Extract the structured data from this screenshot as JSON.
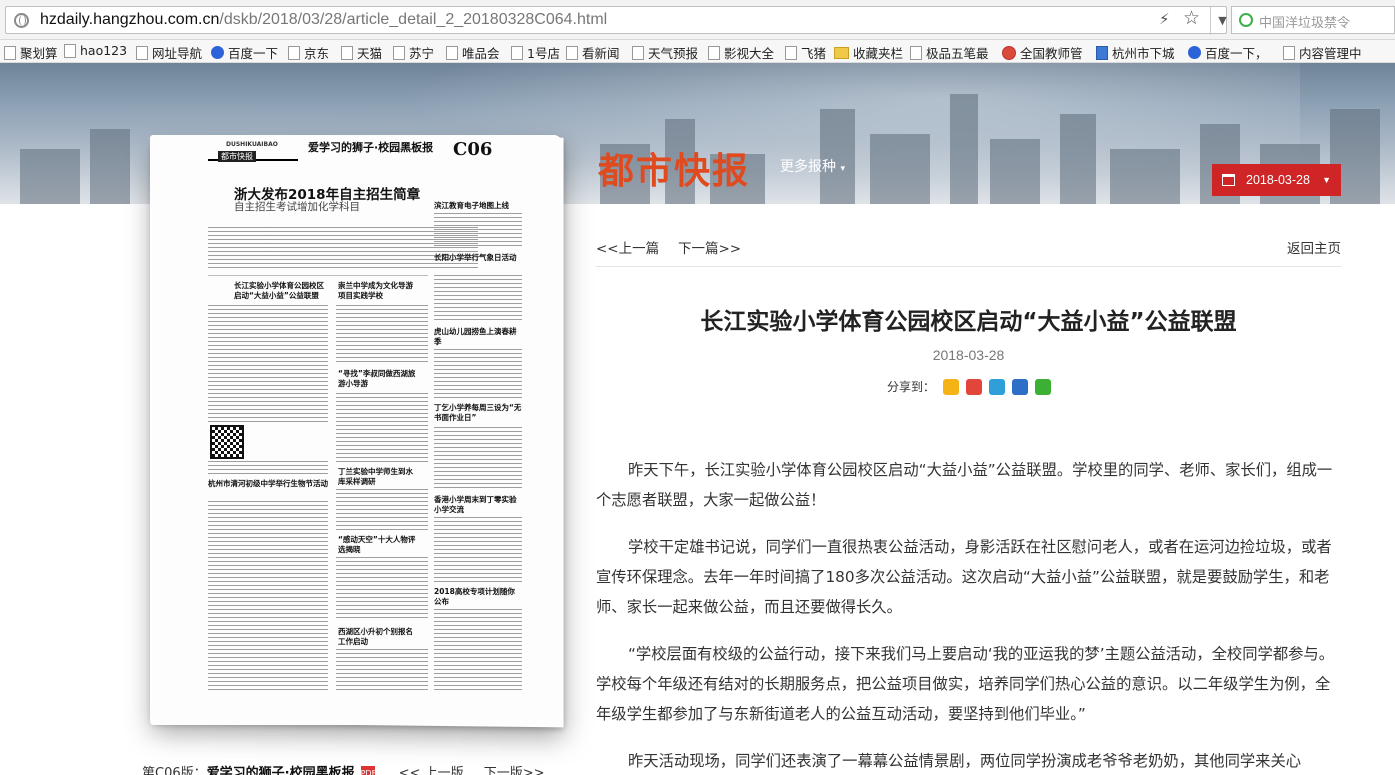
{
  "browser": {
    "url_host": "hzdaily.hangzhou.com.cn",
    "url_path": "/dskb/2018/03/28/article_detail_2_20180328C064.html",
    "search_placeholder": "中国洋垃圾禁令"
  },
  "bookmarks": [
    "聚划算",
    "hao123",
    "网址导航",
    "百度一下",
    "京东",
    "天猫",
    "苏宁",
    "唯品会",
    "1号店",
    "看新闻",
    "天气预报",
    "影视大全",
    "飞猪",
    "收藏夹栏",
    "极品五笔最",
    "全国教师管",
    "杭州市下城",
    "百度一下，",
    "内容管理中"
  ],
  "header": {
    "brand": "都市快报",
    "more_papers": "更多报种",
    "date": "2018-03-28"
  },
  "newspaper": {
    "logo_en": "DUSHIKUAIBAO",
    "logo_cn": "都市快报",
    "section": "爱学习的狮子·校园黑板报",
    "page_no": "C06",
    "headline": "浙大发布2018年自主招生简章",
    "subhead": "自主招生考试增加化学科目",
    "col_heads": [
      "长江实验小学体育公园校区启动“大益小益”公益联盟",
      "崇兰中学成为文化导游项目实践学校",
      "“寻找”李叔同做西湖旅游小导游",
      "丁兰实验中学师生到水库采样调研",
      "“感动天空”十大人物评选揭晓",
      "杭州市清河初级中学举行生物节活动",
      "滨江教育电子地图上线",
      "长阳小学举行气象日活动",
      "虎山幼儿园捞鱼上演春耕季",
      "丁乞小学养每周三设为“无书面作业日”",
      "香港小学周末到丁零实验小学交流",
      "2018高校专项计划随你公布",
      "西湖区小升初个别报名工作启动"
    ],
    "caption_page": "第C06版：",
    "caption_section": "爱学习的狮子·校园黑板报",
    "caption_prev": "<< 上一版",
    "caption_next": "下一版>>"
  },
  "article": {
    "prev": "<<上一篇",
    "next": "下一篇>>",
    "home": "返回主页",
    "title": "长江实验小学体育公园校区启动“大益小益”公益联盟",
    "date": "2018-03-28",
    "share_label": "分享到：",
    "share_icons": [
      {
        "name": "qzone-share-icon",
        "color": "#f5b316"
      },
      {
        "name": "weibo-share-icon",
        "color": "#e2453a"
      },
      {
        "name": "tencent-weibo-share-icon",
        "color": "#2e9fd8"
      },
      {
        "name": "renren-share-icon",
        "color": "#2d6fc6"
      },
      {
        "name": "wechat-share-icon",
        "color": "#3cb035"
      }
    ],
    "paragraphs": [
      "昨天下午，长江实验小学体育公园校区启动“大益小益”公益联盟。学校里的同学、老师、家长们，组成一个志愿者联盟，大家一起做公益！",
      "学校干定雄书记说，同学们一直很热衷公益活动，身影活跃在社区慰问老人，或者在运河边捡垃圾，或者宣传环保理念。去年一年时间搞了180多次公益活动。这次启动“大益小益”公益联盟，就是要鼓励学生，和老师、家长一起来做公益，而且还要做得长久。",
      "“学校层面有校级的公益行动，接下来我们马上要启动‘我的亚运我的梦’主题公益活动，全校同学都参与。学校每个年级还有结对的长期服务点，把公益项目做实，培养同学们热心公益的意识。以二年级学生为例，全年级学生都参加了与东新街道老人的公益互动活动，要坚持到他们毕业。”",
      "昨天活动现场，同学们还表演了一幕幕公益情景剧，两位同学扮演成老爷爷老奶奶，其他同学来关心"
    ]
  },
  "colors": {
    "brand_red": "#e04a1f",
    "date_button": "#cf2527"
  }
}
